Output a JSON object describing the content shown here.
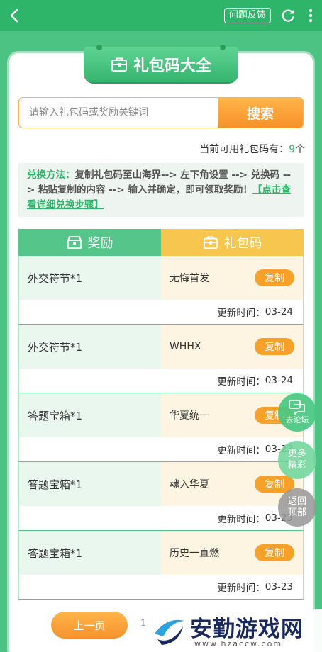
{
  "topbar": {
    "feedback_label": "问题反馈"
  },
  "header": {
    "title": "礼包码大全"
  },
  "search": {
    "placeholder": "请输入礼包码或奖励关键词",
    "button_label": "搜索"
  },
  "count": {
    "prefix": "当前可用礼包码有：",
    "value": "9",
    "suffix": "个"
  },
  "instructions": {
    "label": "兑换方法：",
    "text": "复制礼包码至山海界--> 左下角设置 --> 兑换码 --> 粘贴复制的内容 --> 输入并确定，即可领取奖励！",
    "link": "【点击查看详细兑换步骤】"
  },
  "table": {
    "col_reward": "奖励",
    "col_code": "礼包码",
    "copy_label": "复制",
    "update_prefix": "更新时间：",
    "rows": [
      {
        "reward": "外交符节*1",
        "code": "无悔首发",
        "date": "03-24"
      },
      {
        "reward": "外交符节*1",
        "code": "WHHX",
        "date": "03-24"
      },
      {
        "reward": "答题宝箱*1",
        "code": "华夏统一",
        "date": "03-23"
      },
      {
        "reward": "答题宝箱*1",
        "code": "魂入华夏",
        "date": "03-23"
      },
      {
        "reward": "答题宝箱*1",
        "code": "历史一直燃",
        "date": "03-23"
      }
    ]
  },
  "floating": {
    "forum": "去论坛",
    "more_line1": "更多",
    "more_line2": "精彩",
    "top_line1": "返回",
    "top_line2": "顶部"
  },
  "pager": {
    "prev_label": "上一页",
    "indicator": "1/2"
  },
  "watermark": {
    "title": "安勤游戏网",
    "url": "www.hzaccw.com"
  },
  "colors": {
    "primary_green": "#2fb56a",
    "accent_orange": "#f7a12a"
  }
}
